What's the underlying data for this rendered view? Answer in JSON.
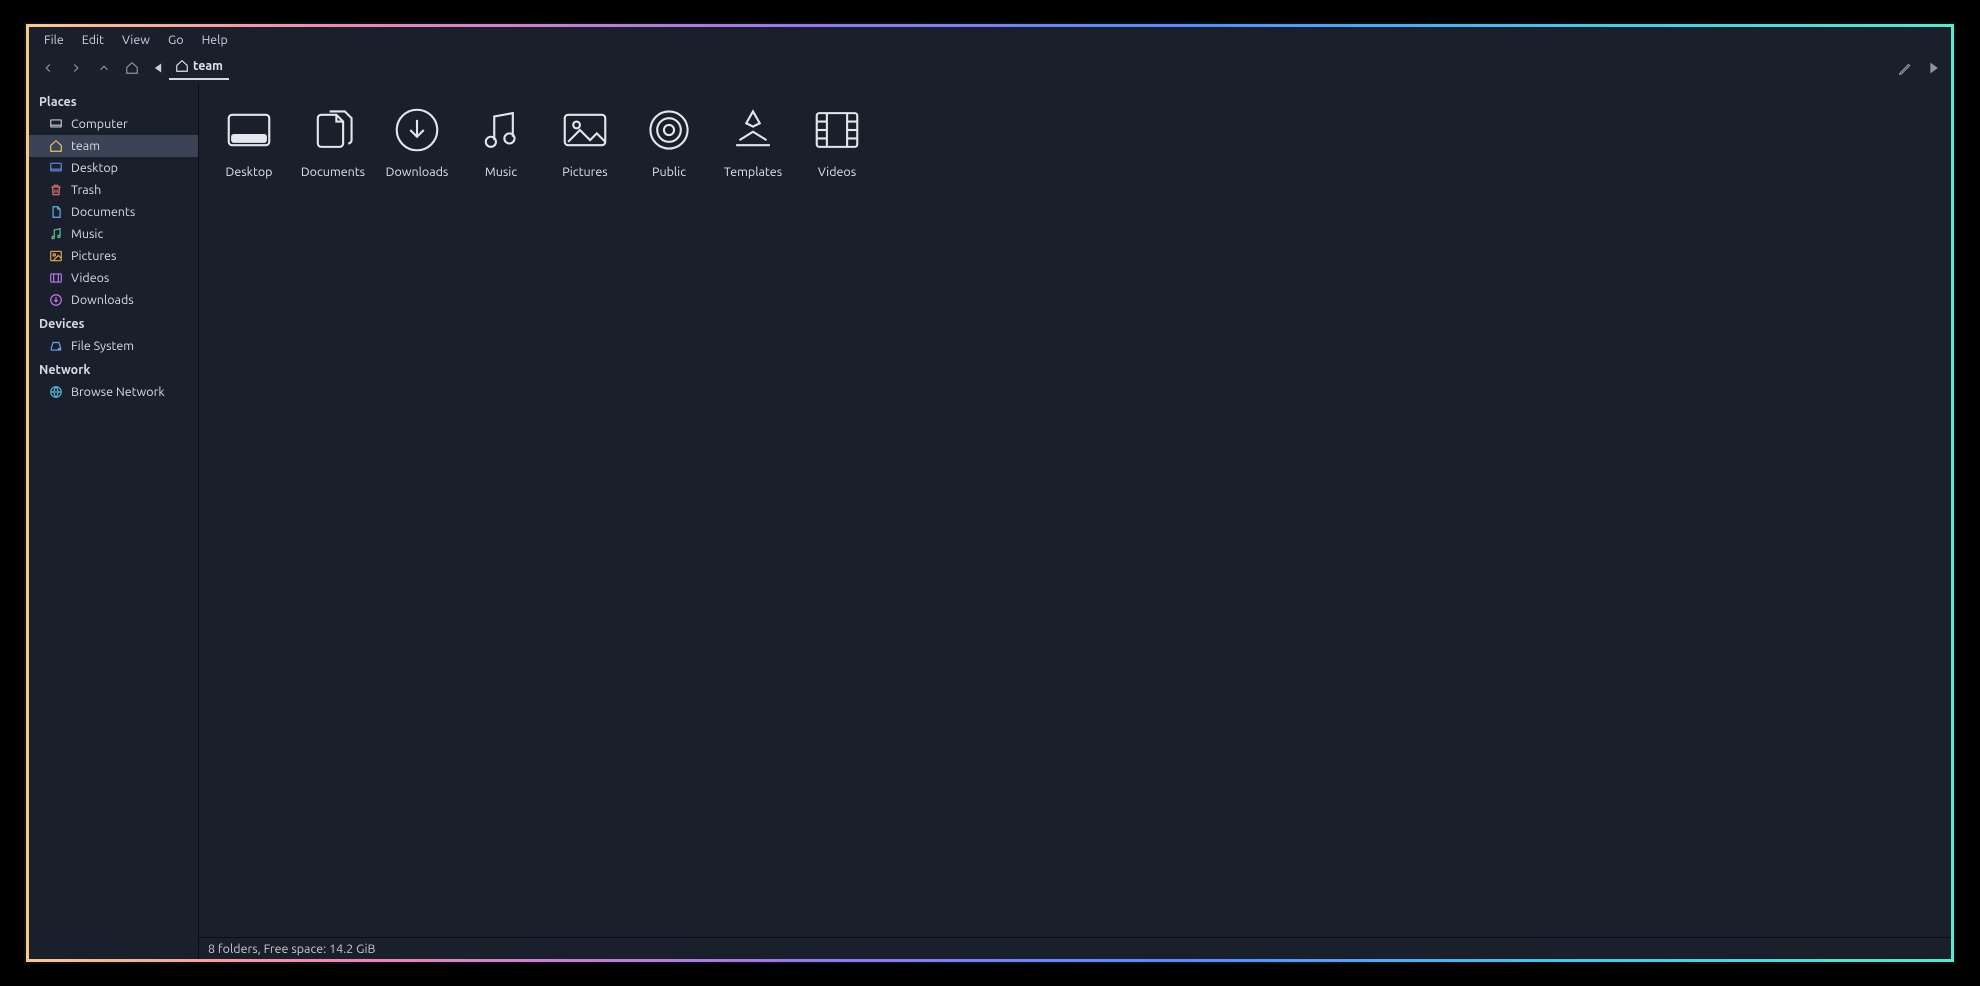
{
  "menubar": [
    "File",
    "Edit",
    "View",
    "Go",
    "Help"
  ],
  "breadcrumb": {
    "label": "team"
  },
  "sidebar": {
    "sections": [
      {
        "header": "Places",
        "items": [
          {
            "ic": "computer",
            "label": "Computer",
            "col": "#c4c8d2"
          },
          {
            "ic": "home",
            "label": "team",
            "selected": true,
            "col": "#e6c56a"
          },
          {
            "ic": "desktop",
            "label": "Desktop",
            "col": "#5f8de4"
          },
          {
            "ic": "trash",
            "label": "Trash",
            "col": "#e57676"
          },
          {
            "ic": "documents",
            "label": "Documents",
            "col": "#62b1e6"
          },
          {
            "ic": "music",
            "label": "Music",
            "col": "#5dc994"
          },
          {
            "ic": "pictures",
            "label": "Pictures",
            "col": "#e8a84e"
          },
          {
            "ic": "videos",
            "label": "Videos",
            "col": "#b97ae8"
          },
          {
            "ic": "downloads",
            "label": "Downloads",
            "col": "#c47de0"
          }
        ]
      },
      {
        "header": "Devices",
        "items": [
          {
            "ic": "disk",
            "label": "File System",
            "col": "#6fa0e0"
          }
        ]
      },
      {
        "header": "Network",
        "items": [
          {
            "ic": "network",
            "label": "Browse Network",
            "col": "#4db8d4"
          }
        ]
      }
    ]
  },
  "grid": [
    {
      "ic": "desktop-folder",
      "label": "Desktop"
    },
    {
      "ic": "documents-folder",
      "label": "Documents"
    },
    {
      "ic": "downloads-folder",
      "label": "Downloads"
    },
    {
      "ic": "music-folder",
      "label": "Music"
    },
    {
      "ic": "pictures-folder",
      "label": "Pictures"
    },
    {
      "ic": "public-folder",
      "label": "Public"
    },
    {
      "ic": "templates-folder",
      "label": "Templates"
    },
    {
      "ic": "videos-folder",
      "label": "Videos"
    }
  ],
  "status": "8 folders, Free space: 14.2 GiB"
}
